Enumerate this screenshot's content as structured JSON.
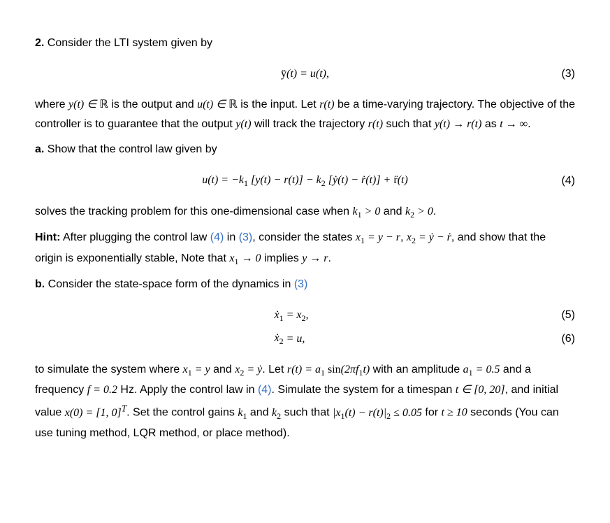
{
  "problem": {
    "number": "2.",
    "intro": "Consider the LTI system given by",
    "eq3": "ÿ(t) = u(t),",
    "eq3_num": "(3)",
    "para1_a": "where ",
    "para1_b": " is the output and ",
    "para1_c": " is the input. Let ",
    "para1_d": " be a time-varying trajectory. The objective of the controller is to guarantee that the output ",
    "para1_e": " will track the trajectory ",
    "para1_f": " such that ",
    "para1_g": " as ",
    "para1_h": ".",
    "y_in_R": "y(t) ∈ ℝ",
    "u_in_R": "u(t) ∈ ℝ",
    "r_t": "r(t)",
    "y_t": "y(t)",
    "y_to_r": "y(t) → r(t)",
    "t_to_inf": "t → ∞",
    "part_a_label": "a.",
    "part_a_text": " Show that the control law given by",
    "eq4": "u(t) = −k₁ [y(t) − r(t)] − k₂ [ẏ(t) − ṙ(t)] + r̈(t)",
    "eq4_num": "(4)",
    "part_a_after_a": "solves the tracking problem for this one-dimensional case when ",
    "k1_pos": "k₁ > 0",
    "and": " and ",
    "k2_pos": "k₂ > 0",
    "period": ".",
    "hint_label": "Hint:",
    "hint_a": " After plugging the control law ",
    "ref4": "(4)",
    "hint_b": " in ",
    "ref3": "(3)",
    "hint_c": ", consider the states ",
    "x1_def": "x₁ = y − r",
    "comma_sp": ", ",
    "x2_def": "x₂ = ẏ − ṙ",
    "hint_d": ", and show that the origin is exponentially stable, Note that ",
    "x1_to_0": "x₁ → 0",
    "hint_e": " implies ",
    "y_to_r_short": "y → r",
    "part_b_label": "b.",
    "part_b_text_a": " Consider the state-space form of the dynamics in ",
    "eq5_lhs": "ẋ₁",
    "eq5_rhs": " = x₂,",
    "eq5_num": "(5)",
    "eq6_lhs": "ẋ₂",
    "eq6_rhs": " = u,",
    "eq6_num": "(6)",
    "part_b_para_a": "to simulate the system where ",
    "x1_y": "x₁ = y",
    "x2_ydot": "x₂ = ẏ",
    "part_b_para_b": ". Let ",
    "r_def": "r(t) = a₁ sin(2πf₁t)",
    "part_b_para_c": " with an amplitude ",
    "a1_val": "a₁ = 0.5",
    "part_b_para_d": " and a frequency ",
    "f_val": "f = 0.2",
    "part_b_para_e": " Hz. Apply the control law in ",
    "part_b_para_f": ". Simulate the system for a timespan ",
    "t_span": "t ∈ [0, 20]",
    "part_b_para_g": ", and initial value ",
    "x0": "x(0) = [1, 0]",
    "x0_sup": "T",
    "part_b_para_h": ". Set the control gains ",
    "k1": "k₁",
    "k2": "k₂",
    "part_b_para_i": " such that ",
    "err_cond": "|x₁(t) − r(t)|₂ ≤ 0.05",
    "part_b_para_j": " for ",
    "t_ge_10": "t ≥ 10",
    "part_b_para_k": " seconds (You can use tuning method, LQR method, or place method)."
  }
}
